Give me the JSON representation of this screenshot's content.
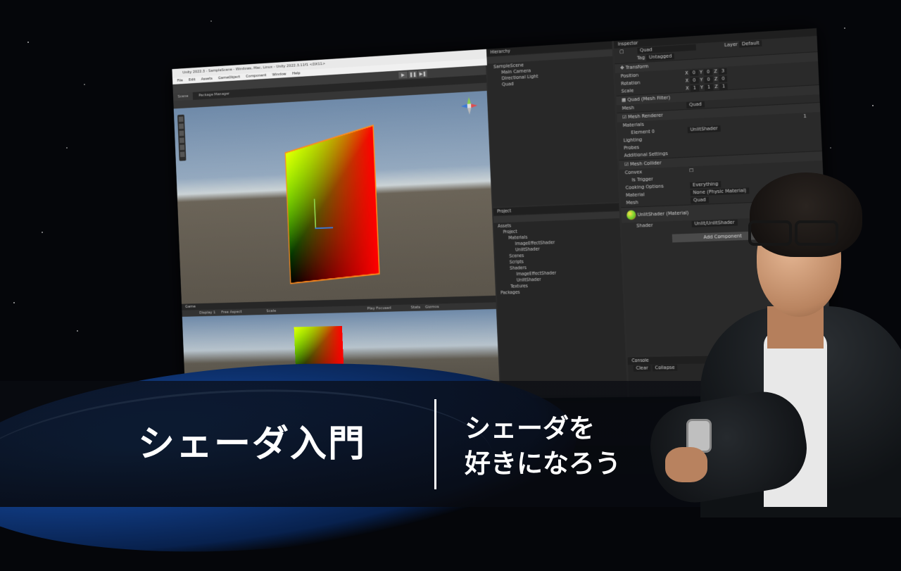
{
  "editor": {
    "title": "Unity 2022.3 - SampleScene - Windows, Mac, Linux - Unity 2022.3.11f1 <DX11>",
    "menu": [
      "File",
      "Edit",
      "Assets",
      "GameObject",
      "Component",
      "Window",
      "Help"
    ],
    "scene_tabs": [
      "Scene",
      "Package Manager"
    ],
    "game_tab": "Game",
    "game_bar": {
      "display": "Display 1",
      "aspect": "Free Aspect",
      "scale": "Scale",
      "play_mode": "Play Focused",
      "stats": "Stats",
      "gizmos": "Gizmos"
    }
  },
  "hierarchy": {
    "title": "Hierarchy",
    "items": [
      "SampleScene",
      "Main Camera",
      "Directional Light",
      "Quad"
    ]
  },
  "project": {
    "title": "Project",
    "items": [
      "Assets",
      "Project",
      "Materials",
      "ImageEffectShader",
      "UnlitShader",
      "Scenes",
      "Scripts",
      "Shaders",
      "ImageEffectShader",
      "UnlitShader",
      "Textures",
      "Packages"
    ]
  },
  "inspector": {
    "title": "Inspector",
    "object_name": "Quad",
    "tag_label": "Tag",
    "tag_value": "Untagged",
    "layer_label": "Layer",
    "layer_value": "Default",
    "transform": {
      "title": "Transform",
      "position_label": "Position",
      "position": [
        "0",
        "0",
        "3"
      ],
      "rotation_label": "Rotation",
      "rotation": [
        "0",
        "0",
        "0"
      ],
      "scale_label": "Scale",
      "scale": [
        "1",
        "1",
        "1"
      ]
    },
    "mesh_filter": {
      "title": "Quad (Mesh Filter)",
      "mesh_label": "Mesh",
      "mesh_value": "Quad"
    },
    "mesh_renderer": {
      "title": "Mesh Renderer",
      "materials_label": "Materials",
      "materials_count": "1",
      "element_label": "Element 0",
      "element_value": "UnlitShader"
    },
    "sections": [
      "Lighting",
      "Probes",
      "Additional Settings"
    ],
    "mesh_collider": {
      "title": "Mesh Collider",
      "convex_label": "Convex",
      "trigger_label": "Is Trigger",
      "cooking_label": "Cooking Options",
      "cooking_value": "Everything",
      "material_label": "Material",
      "material_value": "None (Physic Material)",
      "mesh_label": "Mesh",
      "mesh_value": "Quad"
    },
    "material": {
      "title": "UnlitShader (Material)",
      "shader_label": "Shader",
      "shader_value": "Unlit/UnlitShader"
    },
    "add_component": "Add Component"
  },
  "console": {
    "title": "Console",
    "clear": "Clear",
    "collapse": "Collapse"
  },
  "banner": {
    "title": "シェーダ入門",
    "subtitle_line1": "シェーダを",
    "subtitle_line2": "好きになろう"
  }
}
